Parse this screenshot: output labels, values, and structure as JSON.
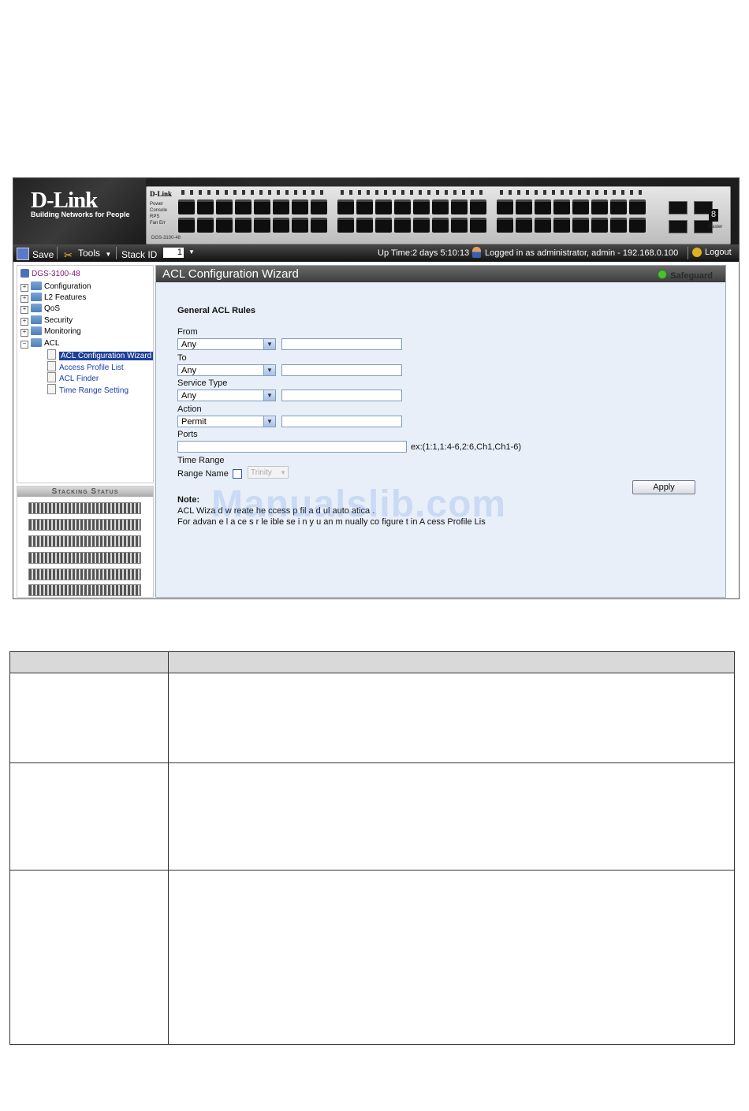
{
  "banner": {
    "logo": "D-Link",
    "tagline": "Building Networks for People",
    "device_brand": "D-Link",
    "device_leds": [
      "Power",
      "Console",
      "RPS",
      "Fan Err"
    ],
    "device_model": "DGS-3100-48",
    "seven_segment": "8",
    "master_label": "Master"
  },
  "toolbar": {
    "save_label": "Save",
    "tools_label": "Tools",
    "stack_id_label": "Stack ID",
    "stack_id_value": "1",
    "uptime": "Up Time:2 days 5:10:13",
    "logged_in": "Logged in as administrator, admin - 192.168.0.100",
    "logout_label": "Logout"
  },
  "tree": {
    "root": "DGS-3100-48",
    "folders": [
      "Configuration",
      "L2 Features",
      "QoS",
      "Security",
      "Monitoring",
      "ACL"
    ],
    "acl_children": [
      "ACL Configuration Wizard",
      "Access Profile List",
      "ACL Finder",
      "Time Range Setting"
    ],
    "selected": "ACL Configuration Wizard"
  },
  "stacking": {
    "title": "Stacking Status",
    "unit_count": 6
  },
  "main": {
    "title": "ACL Configuration Wizard",
    "safeguard": "Safeguard",
    "section_title": "General ACL Rules",
    "from_label": "From",
    "from_value": "Any",
    "to_label": "To",
    "to_value": "Any",
    "service_type_label": "Service Type",
    "service_type_value": "Any",
    "action_label": "Action",
    "action_value": "Permit",
    "ports_label": "Ports",
    "ports_example": "ex:(1:1,1:4-6,2:6,Ch1,Ch1-6)",
    "time_range_label": "Time Range",
    "range_name_label": "Range Name",
    "range_name_value": "Trinity",
    "apply_label": "Apply",
    "note_title": "Note:",
    "note_line1": "ACL Wiza d w   reate  he  ccess  p  fil   a  d  ul   auto  atica   .",
    "note_line2": "For advan e  l  a  ce  s   r  le  ible se  i  n  y  u  an  m  nually co  figure  t in A  cess Profile Lis"
  },
  "watermark": "Manualslib.com"
}
